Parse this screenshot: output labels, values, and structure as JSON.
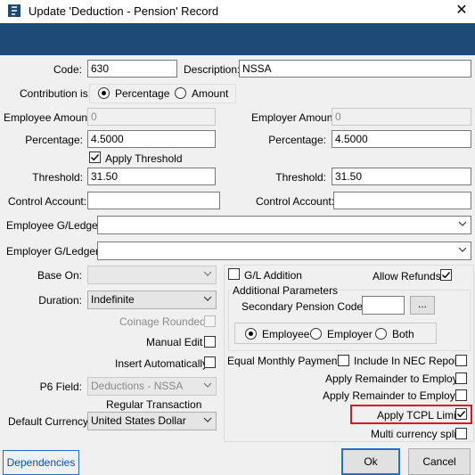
{
  "window": {
    "title": "Update 'Deduction - Pension' Record",
    "close": "✕"
  },
  "form": {
    "code_label": "Code:",
    "code_value": "630",
    "description_label": "Description:",
    "description_value": "NSSA",
    "contribution_label": "Contribution is:",
    "contribution_options": [
      "Percentage",
      "Amount"
    ],
    "contribution_selected": "Percentage",
    "employee_amount_label": "Employee Amount:",
    "employee_amount_value": "0",
    "employer_amount_label": "Employer Amount:",
    "employer_amount_value": "0",
    "employee_percentage_label": "Percentage:",
    "employee_percentage_value": "4.5000",
    "employer_percentage_label": "Percentage:",
    "employer_percentage_value": "4.5000",
    "apply_threshold_label": "Apply Threshold",
    "employee_threshold_label": "Threshold:",
    "employee_threshold_value": "31.50",
    "employer_threshold_label": "Threshold:",
    "employer_threshold_value": "31.50",
    "employee_control_label": "Control Account:",
    "employee_control_value": "",
    "employer_control_label": "Control Account:",
    "employer_control_value": "",
    "employee_gl_label": "Employee G/Ledger:",
    "employee_gl_value": "",
    "employer_gl_label": "Employer G/Ledger:",
    "employer_gl_value": ""
  },
  "left": {
    "base_on_label": "Base On:",
    "base_on_value": "",
    "duration_label": "Duration:",
    "duration_value": "Indefinite",
    "coinage_label": "Coinage Rounded",
    "manual_edit_label": "Manual Edit",
    "insert_auto_label": "Insert Automatically",
    "p6_label": "P6 Field:",
    "p6_value": "Deductions - NSSA",
    "regular_transaction_label": "Regular Transaction",
    "default_currency_label": "Default Currency:",
    "default_currency_value": "United States Dollar"
  },
  "right": {
    "gl_addition_label": "G/L Addition",
    "allow_refunds_label": "Allow Refunds",
    "additional_parameters_label": "Additional Parameters",
    "secondary_pension_label": "Secondary Pension Code:",
    "secondary_pension_value": "",
    "browse_label": "...",
    "party_options": [
      "Employee",
      "Employer",
      "Both"
    ],
    "party_selected": "Employee",
    "equal_monthly_label": "Equal Monthly Payments",
    "include_nec_label": "Include In NEC Report",
    "remainder_employer_label": "Apply Remainder to Employer",
    "remainder_employee_label": "Apply Remainder to Employee",
    "apply_tcpl_label": "Apply TCPL Limit",
    "multi_currency_label": "Multi currency split"
  },
  "checks": {
    "apply_threshold": true,
    "coinage_rounded": false,
    "manual_edit": false,
    "insert_automatically": false,
    "gl_addition": false,
    "allow_refunds": true,
    "equal_monthly": false,
    "include_nec": false,
    "remainder_employer": false,
    "remainder_employee": false,
    "apply_tcpl": true,
    "multi_currency": false
  },
  "footer": {
    "dependencies_label": "Dependencies",
    "ok_label": "Ok",
    "cancel_label": "Cancel"
  },
  "colors": {
    "header_band": "#1e4a78",
    "highlight": "#e0141e",
    "focus_border": "#1e6fd0"
  }
}
